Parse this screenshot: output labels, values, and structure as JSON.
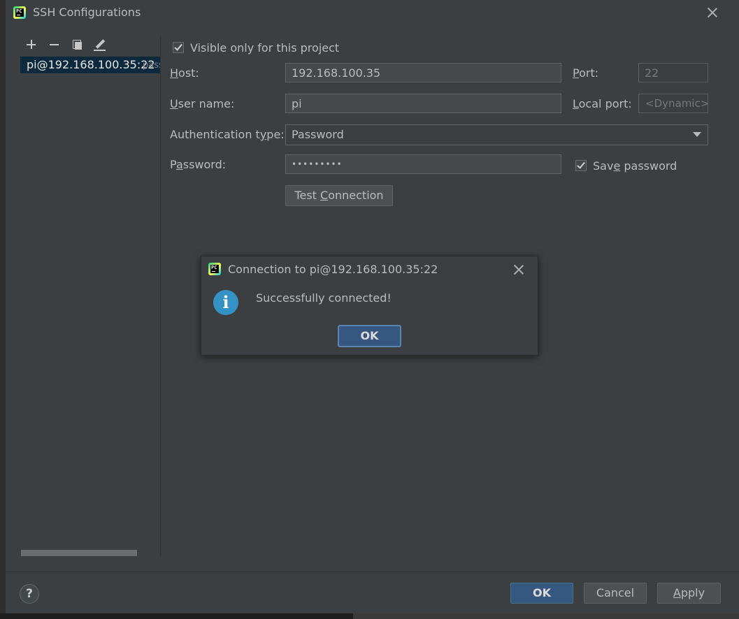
{
  "window": {
    "title": "SSH Configurations",
    "logo_text": "PC"
  },
  "left": {
    "toolbar": [
      "add-icon",
      "remove-icon",
      "copy-icon",
      "edit-icon"
    ],
    "items": [
      {
        "host": "pi@192.168.100.35:22",
        "auth": "password"
      }
    ]
  },
  "form": {
    "visible_only_label": "Visible only for this project",
    "visible_only_checked": true,
    "host_label_pre": "",
    "host_label_mn": "H",
    "host_label_post": "ost:",
    "host_value": "192.168.100.35",
    "port_label_pre": "",
    "port_label_mn": "P",
    "port_label_post": "ort:",
    "port_value": "22",
    "user_label_pre": "",
    "user_label_mn": "U",
    "user_label_post": "ser name:",
    "user_value": "pi",
    "local_port_label_pre": "",
    "local_port_label_mn": "L",
    "local_port_label_post": "ocal port:",
    "local_port_value": "<Dynamic>",
    "auth_label_pre": "Authentication t",
    "auth_label_mn": "y",
    "auth_label_post": "pe:",
    "auth_value": "Password",
    "password_label_pre": "P",
    "password_label_mn": "a",
    "password_label_post": "ssword:",
    "password_value": "•••••••••",
    "save_password_pre": "Sav",
    "save_password_mn": "e",
    "save_password_post": " password",
    "save_password_checked": true,
    "test_pre": "Test ",
    "test_mn": "C",
    "test_post": "onnection"
  },
  "footer": {
    "help": "?",
    "ok": "OK",
    "cancel": "Cancel",
    "apply_mn": "A",
    "apply_post": "pply"
  },
  "dialog": {
    "title": "Connection to pi@192.168.100.35:22",
    "message": "Successfully connected!",
    "ok": "OK",
    "icon": "info-icon"
  }
}
